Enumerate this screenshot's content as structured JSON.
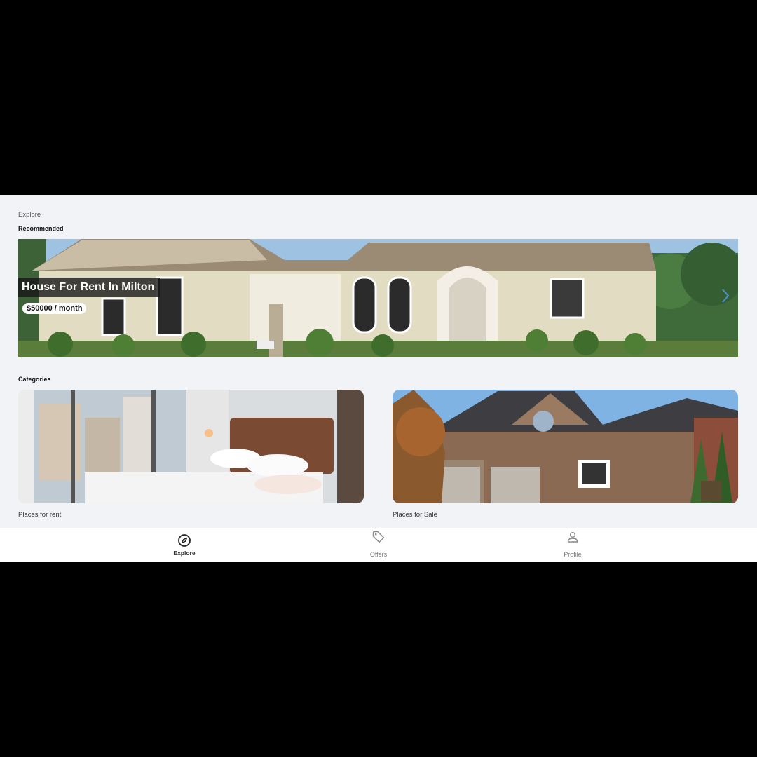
{
  "header": {
    "page_label": "Explore"
  },
  "recommended": {
    "section_title": "Recommended",
    "featured": {
      "title": "House For Rent In Milton",
      "price": "$50000 / month"
    },
    "next_icon": "chevron-right-icon"
  },
  "categories": {
    "section_title": "Categories",
    "items": [
      {
        "label": "Places for rent"
      },
      {
        "label": "Places for Sale"
      }
    ]
  },
  "bottom_nav": {
    "items": [
      {
        "label": "Explore",
        "icon": "compass-icon",
        "active": true
      },
      {
        "label": "Offers",
        "icon": "tag-icon",
        "active": false
      },
      {
        "label": "Profile",
        "icon": "person-icon",
        "active": false
      }
    ]
  },
  "colors": {
    "background": "#f2f3f7",
    "nav_background": "#ffffff",
    "active_text": "#333333",
    "inactive_text": "#777777"
  }
}
